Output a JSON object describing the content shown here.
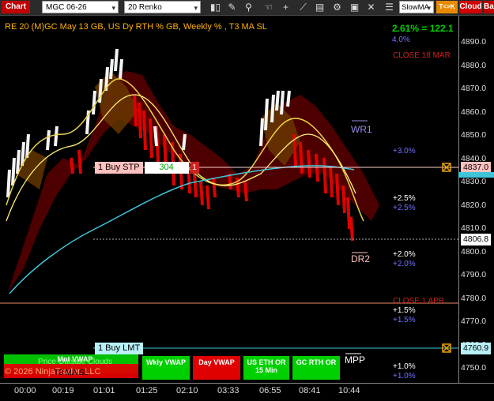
{
  "toolbar": {
    "chart_tab": "Chart",
    "instrument": "MGC 06-26",
    "bar_type": "20 Renko",
    "indicator_select": "SlowMA",
    "btn_tk": "T<>K",
    "btn_cloud": "Cloud",
    "btn_bar": "Bar"
  },
  "chart": {
    "title": "RE 20  (M)GC May 13 GB, US Dy RTH % GB, Weekly % , T3 MA SL",
    "pct_change": "2.61% = 122.1",
    "pct_small": "4.0%",
    "close_label": "CLOSE 18 MAR",
    "close_apr": "CLOSE 1 APR",
    "wr1": "WR1",
    "dr2": "DR2",
    "mpp": "MPP",
    "levels": {
      "p30": "+3.0%",
      "p25a": "+2.5%",
      "p25b": "+2.5%",
      "p20a": "+2.0%",
      "p20b": "+2.0%",
      "p15a": "+1.5%",
      "p15b": "+1.5%",
      "p10a": "+1.0%",
      "p10b": "+1.0%"
    },
    "order_buy_stp": {
      "label": "1 Buy STP",
      "price": "304",
      "qty": "1"
    },
    "order_buy_lmt": {
      "label": "1 Buy LMT"
    },
    "copyright": "© 2026 NinjaTrader, LLC",
    "indicators": {
      "mnt_vwap": "Mnt VWAP",
      "price_outside": "Price Outside Clouds",
      "t3": "T3 MA SL",
      "wkly_vwap": "Wkly VWAP",
      "day_vwap": "Day VWAP",
      "us_eth": "US ETH OR 15 Min",
      "gc_rth": "GC RTH OR"
    },
    "price_boxes": {
      "p1": "4837.0",
      "p2": "4806.8",
      "p3": "4760.9"
    },
    "colors": {
      "green": "#00d000",
      "red": "#e00000",
      "cyan": "#3ec6d8",
      "yellow": "#e8d24a"
    }
  },
  "y_ticks": [
    "4890.0",
    "4880.0",
    "4870.0",
    "4860.0",
    "4850.0",
    "4840.0",
    "4830.0",
    "4820.0",
    "4810.0",
    "4800.0",
    "4790.0",
    "4780.0",
    "4770.0",
    "4760.0",
    "4750.0"
  ],
  "x_ticks": [
    "00:00",
    "00:19",
    "01:01",
    "01:25",
    "02:10",
    "03:33",
    "06:55",
    "08:41",
    "10:44"
  ]
}
